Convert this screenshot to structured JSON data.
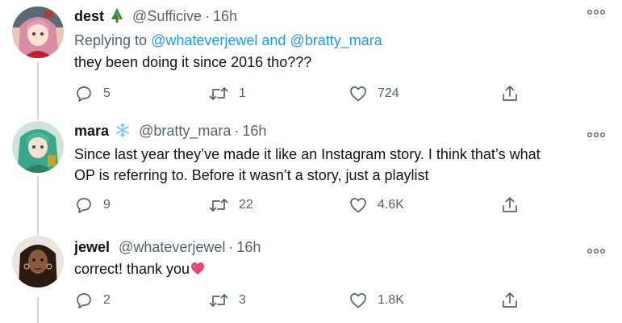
{
  "tweets": [
    {
      "name": "dest",
      "name_emoji": "christmas-tree",
      "handle": "@Sufficive",
      "separator": "·",
      "time": "16h",
      "reply_prefix": "Replying to ",
      "reply_user_1": "@whateverjewel",
      "reply_and": " and ",
      "reply_user_2": "@bratty_mara",
      "text": "they been doing it since 2016 tho???",
      "replies": "5",
      "retweets": "1",
      "likes": "724"
    },
    {
      "name": "mara",
      "name_emoji": "snowflake",
      "handle": "@bratty_mara",
      "separator": "·",
      "time": "16h",
      "text_line_1": "Since last year they’ve made it like an Instagram story. I think that’s what",
      "text_line_2": "OP is referring to. Before it wasn’t a story, just a playlist",
      "replies": "9",
      "retweets": "22",
      "likes": "4.6K"
    },
    {
      "name": "jewel",
      "handle": "@whateverjewel",
      "separator": "·",
      "time": "16h",
      "text": "correct! thank you",
      "text_emoji": "pink-heart",
      "replies": "2",
      "retweets": "3",
      "likes": "1.8K"
    }
  ],
  "colors": {
    "link": "#1d9bf0",
    "muted": "#536471",
    "thread_line": "#cfd9de",
    "heart": "#e0245e"
  },
  "icons": [
    "reply-icon",
    "retweet-icon",
    "like-icon",
    "share-icon",
    "more-options-icon"
  ]
}
